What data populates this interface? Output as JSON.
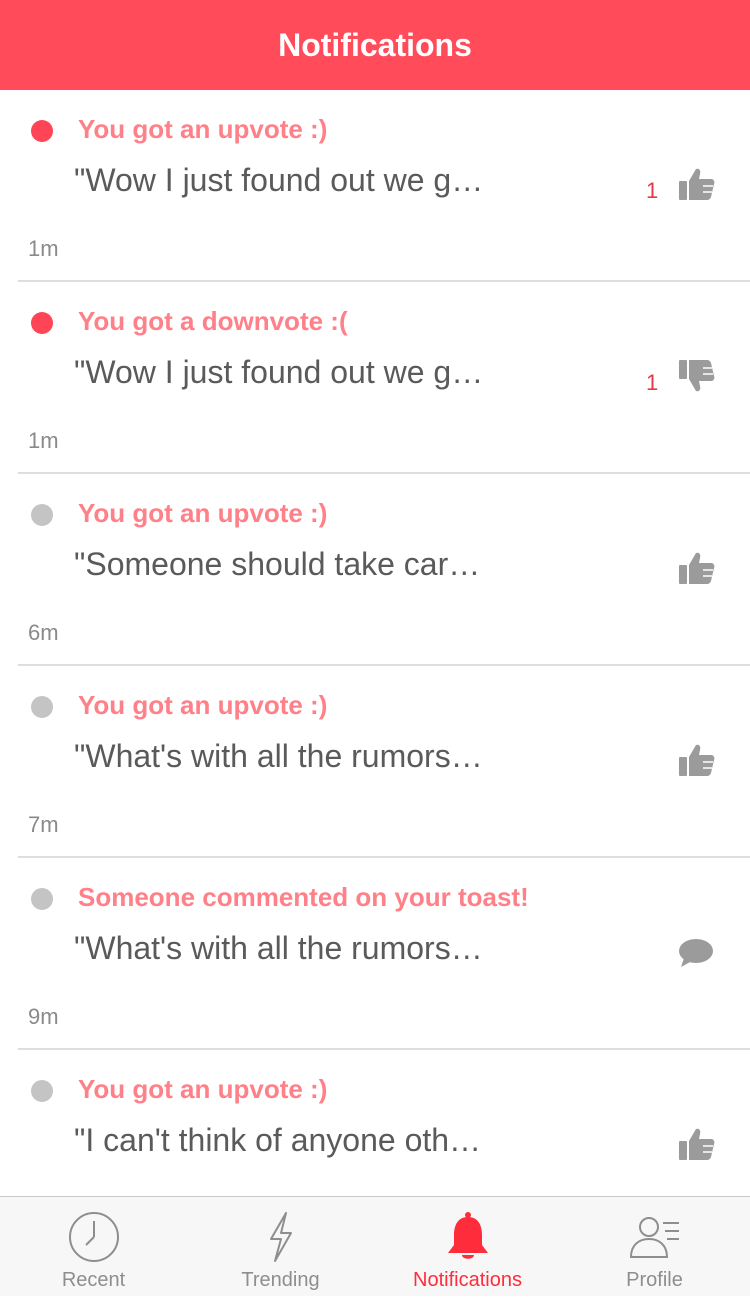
{
  "header": {
    "title": "Notifications"
  },
  "notifications": [
    {
      "status": "unread",
      "title": "You got an upvote :)",
      "preview": "\"Wow I just found out we g…",
      "time": "1m",
      "count": "1",
      "icon": "thumbs-up-icon"
    },
    {
      "status": "unread",
      "title": "You got a downvote :(",
      "preview": "\"Wow I just found out we g…",
      "time": "1m",
      "count": "1",
      "icon": "thumbs-down-icon"
    },
    {
      "status": "read",
      "title": "You got an upvote :)",
      "preview": "\"Someone should take car…",
      "time": "6m",
      "count": "",
      "icon": "thumbs-up-icon"
    },
    {
      "status": "read",
      "title": "You got an upvote :)",
      "preview": "\"What's with all the rumors…",
      "time": "7m",
      "count": "",
      "icon": "thumbs-up-icon"
    },
    {
      "status": "read",
      "title": "Someone commented on your toast!",
      "preview": "\"What's with all the rumors…",
      "time": "9m",
      "count": "",
      "icon": "comment-icon"
    },
    {
      "status": "read",
      "title": "You got an upvote :)",
      "preview": "\"I can't think of anyone oth…",
      "time": "",
      "count": "",
      "icon": "thumbs-up-icon"
    }
  ],
  "tabs": [
    {
      "label": "Recent",
      "icon": "clock-icon",
      "active": false
    },
    {
      "label": "Trending",
      "icon": "lightning-icon",
      "active": false
    },
    {
      "label": "Notifications",
      "icon": "bell-icon",
      "active": true
    },
    {
      "label": "Profile",
      "icon": "profile-icon",
      "active": false
    }
  ],
  "colors": {
    "accent": "#ff4b5a",
    "title_text": "#ff8088",
    "unread_dot": "#ff4455",
    "read_dot": "#c4c4c4",
    "active_tab": "#ff2d3c"
  }
}
